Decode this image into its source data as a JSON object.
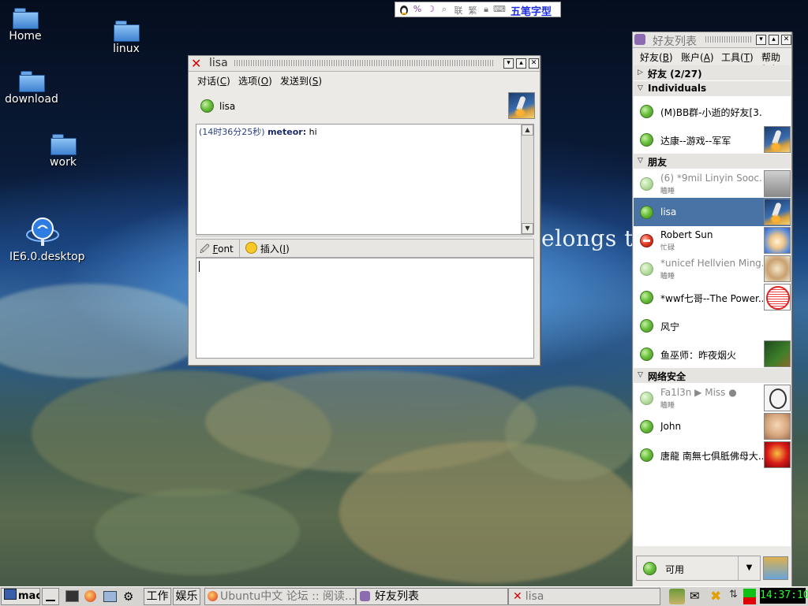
{
  "desktop": {
    "background_text": "elongs to",
    "icons": [
      {
        "label": "Home"
      },
      {
        "label": "linux"
      },
      {
        "label": "download"
      },
      {
        "label": "work"
      },
      {
        "label": "IE6.0.desktop"
      }
    ]
  },
  "ime_bar": {
    "labels": [
      "繁",
      "联"
    ],
    "input_method": "五笔字型"
  },
  "chat_window": {
    "title": "lisa",
    "menu": [
      {
        "label": "对话(",
        "key": "C",
        "end": ")"
      },
      {
        "label": "选项(",
        "key": "O",
        "end": ")"
      },
      {
        "label": "发送到(",
        "key": "S",
        "end": ")"
      }
    ],
    "contact_name": "lisa",
    "history": [
      {
        "time": "(14时36分25秒)",
        "sender": "meteor:",
        "text": " hi"
      }
    ],
    "toolbar": {
      "font_label_key": "F",
      "font_label_rest": "ont",
      "insert_label": "插入(",
      "insert_key": "I",
      "insert_end": ")"
    },
    "compose_value": ""
  },
  "buddy_window": {
    "title": "好友列表",
    "menu": [
      {
        "label": "好友(",
        "key": "B",
        "end": ")"
      },
      {
        "label": "账户(",
        "key": "A",
        "end": ")"
      },
      {
        "label": "工具(",
        "key": "T",
        "end": ")"
      },
      {
        "label": "帮助(",
        "key": "H",
        "end": ")"
      }
    ],
    "groups": {
      "friends_collapsed": "好友 (2/27)",
      "individuals": "Individuals",
      "pengyou": "朋友",
      "netsec": "网络安全"
    },
    "buddies": [
      {
        "name": "(M)BB群-小逝的好友[3...",
        "sub": "",
        "status": "available"
      },
      {
        "name": "达康--游戏--军军",
        "sub": "",
        "status": "available"
      },
      {
        "name": "(6) *9mil Linyin Sooc...",
        "sub": "瞌睡",
        "status": "idle"
      },
      {
        "name": "lisa",
        "sub": "",
        "status": "available"
      },
      {
        "name": "Robert Sun",
        "sub": "忙碌",
        "status": "busy"
      },
      {
        "name": "*unicef Hellvien Ming...",
        "sub": "瞌睡",
        "status": "idle"
      },
      {
        "name": "*wwf七哥--The Power...",
        "sub": "",
        "status": "available"
      },
      {
        "name": "风宁",
        "sub": "",
        "status": "available"
      },
      {
        "name": "鱼巫师：昨夜烟火",
        "sub": "",
        "status": "available"
      },
      {
        "name": "Fa1l3n ▶ Miss ●",
        "sub": "瞌睡",
        "status": "idle"
      },
      {
        "name": "John",
        "sub": "",
        "status": "available"
      },
      {
        "name": "唐龍 南無七俱胝佛母大...",
        "sub": "",
        "status": "available"
      }
    ],
    "status_selector": "可用"
  },
  "taskbar": {
    "start_label": "mac",
    "workspace_1": "工作",
    "workspace_2": "娱乐",
    "tasks": [
      {
        "label": "Ubuntu中文 论坛 :: 阅读..."
      },
      {
        "label": "好友列表"
      },
      {
        "label": "lisa"
      }
    ],
    "clock": "14:37:10"
  }
}
